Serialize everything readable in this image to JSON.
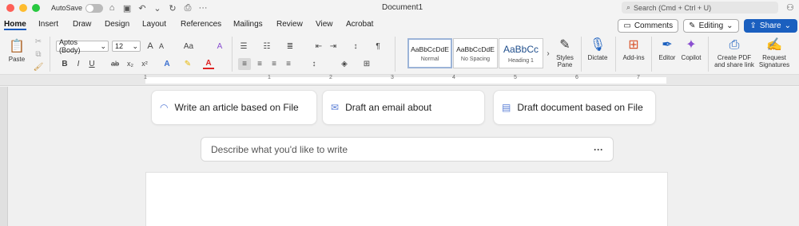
{
  "titlebar": {
    "autosave_label": "AutoSave",
    "document_title": "Document1",
    "search_placeholder": "Search (Cmd + Ctrl + U)"
  },
  "tabs": [
    "Home",
    "Insert",
    "Draw",
    "Design",
    "Layout",
    "References",
    "Mailings",
    "Review",
    "View",
    "Acrobat"
  ],
  "actions": {
    "comments": "Comments",
    "editing": "Editing",
    "share": "Share"
  },
  "ribbon": {
    "paste": "Paste",
    "font_name": "Aptos (Body)",
    "font_size": "12",
    "case_label": "Aa",
    "bold": "B",
    "italic": "I",
    "underline": "U",
    "strike": "ab",
    "subscript": "x₂",
    "superscript": "x²",
    "grow_font": "A",
    "shrink_font": "A",
    "styles": [
      {
        "sample": "AaBbCcDdE",
        "name": "Normal"
      },
      {
        "sample": "AaBbCcDdE",
        "name": "No Spacing"
      },
      {
        "sample": "AaBbCc",
        "name": "Heading 1"
      }
    ],
    "styles_pane": "Styles Pane",
    "dictate": "Dictate",
    "addins": "Add-ins",
    "editor": "Editor",
    "copilot": "Copilot",
    "create_pdf": "Create PDF and share link",
    "request_sign": "Request Signatures"
  },
  "ruler_numbers": [
    "1",
    "1",
    "2",
    "3",
    "4",
    "5",
    "6",
    "7"
  ],
  "suggestions": [
    {
      "label": "Write an article based on File",
      "icon": "copilot-spark-icon"
    },
    {
      "label": "Draft an email about",
      "icon": "email-icon"
    },
    {
      "label": "Draft document based on File",
      "icon": "document-icon"
    }
  ],
  "describe": {
    "placeholder": "Describe what you'd like to write",
    "more": "···"
  },
  "colors": {
    "accent": "#185abd",
    "share": "#1a5fbf"
  }
}
